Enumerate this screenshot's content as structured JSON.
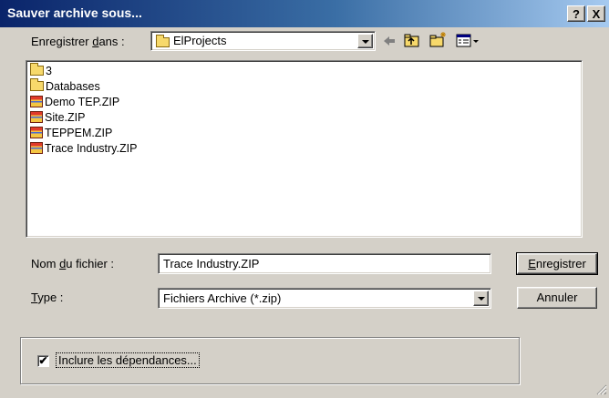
{
  "window": {
    "title": "Sauver archive sous...",
    "help_label": "?",
    "close_label": "X"
  },
  "save_in": {
    "label_prefix": "Enregistrer ",
    "label_accel": "d",
    "label_suffix": "ans :",
    "value": "ElProjects"
  },
  "toolbar": {
    "back_icon": "back-arrow-icon",
    "up_icon": "up-folder-icon",
    "new_folder_icon": "new-folder-icon",
    "view_icon": "view-menu-icon"
  },
  "files": [
    {
      "name": "3",
      "kind": "folder"
    },
    {
      "name": "Databases",
      "kind": "folder"
    },
    {
      "name": "Demo TEP.ZIP",
      "kind": "zip"
    },
    {
      "name": "Site.ZIP",
      "kind": "zip"
    },
    {
      "name": "TEPPEM.ZIP",
      "kind": "zip"
    },
    {
      "name": "Trace Industry.ZIP",
      "kind": "zip"
    }
  ],
  "filename": {
    "label_prefix": "Nom ",
    "label_accel": "d",
    "label_suffix": "u fichier :",
    "value": "Trace Industry.ZIP"
  },
  "type": {
    "label_accel": "T",
    "label_suffix": "ype :",
    "value": "Fichiers Archive (*.zip)"
  },
  "buttons": {
    "save_accel": "E",
    "save_rest": "nregistrer",
    "cancel": "Annuler"
  },
  "options": {
    "include_deps_label": "Inclure les dépendances...",
    "include_deps_checked": true,
    "check_mark": "✔"
  }
}
